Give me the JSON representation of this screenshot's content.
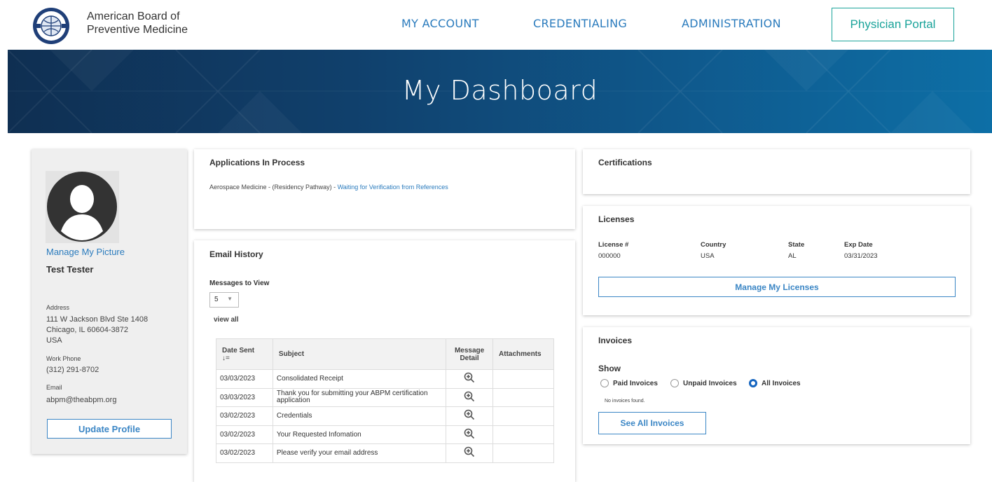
{
  "header": {
    "org_name_line1": "American Board of",
    "org_name_line2": "Preventive Medicine",
    "nav": [
      "MY ACCOUNT",
      "CREDENTIALING",
      "ADMINISTRATION"
    ],
    "portal_button": "Physician Portal"
  },
  "banner": {
    "title": "My Dashboard"
  },
  "profile": {
    "manage_picture": "Manage My Picture",
    "name": "Test Tester",
    "address_label": "Address",
    "address_lines": [
      "111 W Jackson Blvd Ste 1408",
      "Chicago, IL 60604-3872",
      "USA"
    ],
    "work_phone_label": "Work Phone",
    "work_phone": "(312) 291-8702",
    "email_label": "Email",
    "email": "abpm@theabpm.org",
    "update_button": "Update Profile"
  },
  "applications": {
    "title": "Applications In Process",
    "item_text": "Aerospace Medicine - (Residency Pathway) - ",
    "item_status": "Waiting for Verification from References"
  },
  "email_history": {
    "title": "Email History",
    "messages_label": "Messages to View",
    "messages_value": "5",
    "view_all": "view all",
    "columns": {
      "date": "Date Sent",
      "sort_glyph": "↓=",
      "subject": "Subject",
      "detail_line1": "Message",
      "detail_line2": "Detail",
      "attachments": "Attachments"
    },
    "rows": [
      {
        "date": "03/03/2023",
        "subject": "Consolidated Receipt"
      },
      {
        "date": "03/03/2023",
        "subject": "Thank you for submitting your ABPM certification application"
      },
      {
        "date": "03/02/2023",
        "subject": "Credentials"
      },
      {
        "date": "03/02/2023",
        "subject": "Your Requested Infomation"
      },
      {
        "date": "03/02/2023",
        "subject": "Please verify your email address"
      }
    ]
  },
  "certifications": {
    "title": "Certifications"
  },
  "licenses": {
    "title": "Licenses",
    "columns": [
      "License #",
      "Country",
      "State",
      "Exp Date"
    ],
    "row": [
      "000000",
      "USA",
      "AL",
      "03/31/2023"
    ],
    "manage_button": "Manage My Licenses"
  },
  "invoices": {
    "title": "Invoices",
    "show_label": "Show",
    "options": [
      "Paid Invoices",
      "Unpaid Invoices",
      "All Invoices"
    ],
    "selected": "All Invoices",
    "empty_text": "No invoices found.",
    "see_all_button": "See All Invoices"
  },
  "colors": {
    "link": "#2a7bbd",
    "portal": "#1aa39a",
    "button": "#3b86c5",
    "banner": "#10406c"
  }
}
